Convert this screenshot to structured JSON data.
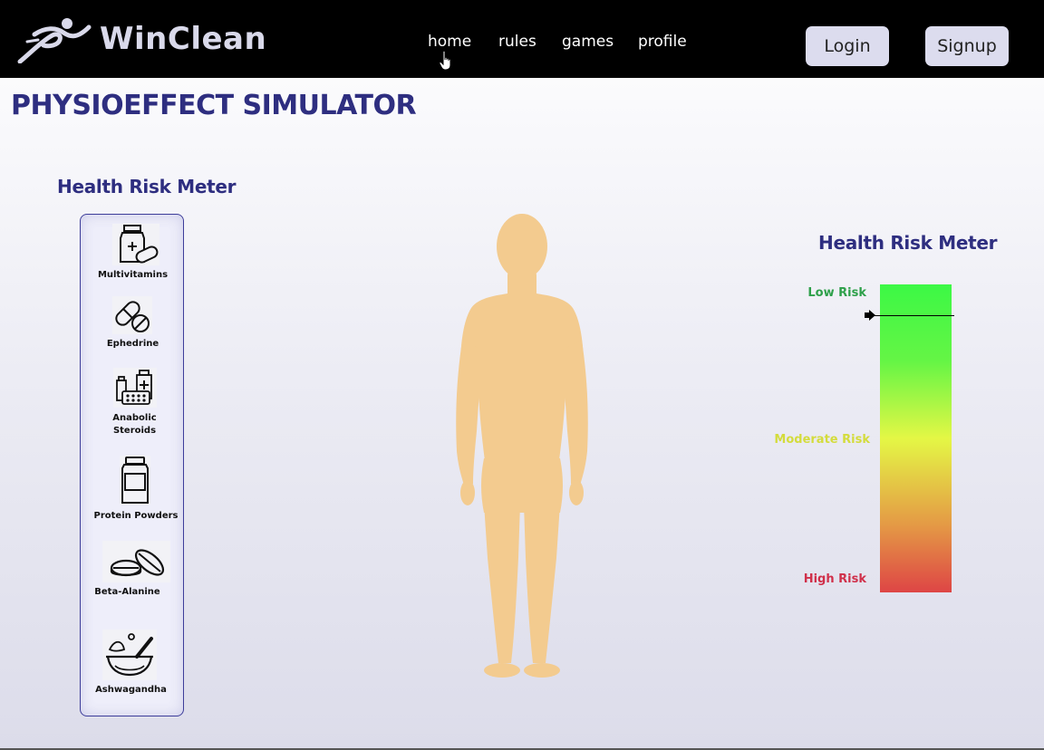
{
  "header": {
    "brand": "WinClean",
    "nav": [
      "home",
      "rules",
      "games",
      "profile"
    ],
    "login_label": "Login",
    "signup_label": "Signup"
  },
  "page": {
    "title": "PHYSIOEFFECT SIMULATOR"
  },
  "supplements": {
    "heading": "Health Risk Meter",
    "items": [
      {
        "label": "Multivitamins",
        "icon": "pill-bottle-icon"
      },
      {
        "label": "Ephedrine",
        "icon": "capsule-icon"
      },
      {
        "label": "Anabolic Steroids",
        "icon": "medicine-set-icon"
      },
      {
        "label": "Protein Powders",
        "icon": "protein-jar-icon"
      },
      {
        "label": "Beta-Alanine",
        "icon": "tablets-icon"
      },
      {
        "label": "Ashwagandha",
        "icon": "mortar-pestle-icon"
      }
    ]
  },
  "risk_meter": {
    "heading": "Health Risk Meter",
    "low_label": "Low Risk",
    "moderate_label": "Moderate Risk",
    "high_label": "High Risk",
    "indicator_level": 0.1,
    "colors": {
      "low": "#2ea04a",
      "moderate": "#d4dc3c",
      "high": "#d0304a",
      "gradient_top": "#3cf845",
      "gradient_mid": "#e4f745",
      "gradient_bottom": "#de4545"
    }
  },
  "colors": {
    "accent": "#2e2e80",
    "header_bg": "#000000",
    "button_bg": "#dcdcee",
    "skin": "#f3cb8f"
  }
}
